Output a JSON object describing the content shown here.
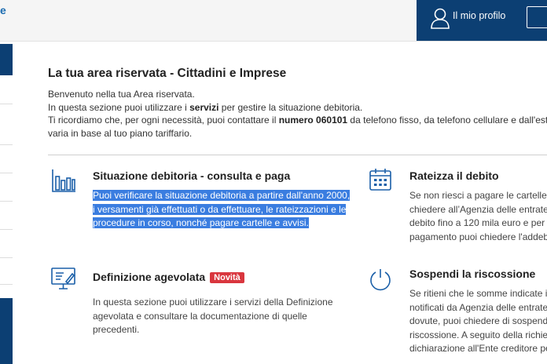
{
  "header": {
    "brand_fragment": "e",
    "profile_label": "Il mio profilo"
  },
  "page": {
    "title": "La tua area riservata - Cittadini e Imprese",
    "intro": {
      "line1": "Benvenuto nella tua Area riservata.",
      "line2_pre": "In questa sezione puoi utilizzare i ",
      "line2_bold": "servizi",
      "line2_post": " per gestire la situazione debitoria.",
      "line3_pre": "Ti ricordiamo che, per ogni necessità, puoi contattare il ",
      "line3_bold": "numero 060101",
      "line3_post": " da telefono fisso, da telefono cellulare e dall'estero",
      "line4": "varia in base al tuo piano tariffario."
    }
  },
  "cards": {
    "situazione": {
      "title": "Situazione debitoria - consulta e paga",
      "lines": [
        "Puoi verificare la situazione debitoria a partire dall'anno 2000,",
        "i versamenti già effettuati o da effettuare, le rateizzazioni e le",
        "procedure in corso, nonché pagare cartelle e avvisi."
      ]
    },
    "rateizza": {
      "title": "Rateizza il debito",
      "lines": [
        "Se non riesci a pagare le cartelle in",
        "chiedere all’Agenzia delle entrate-",
        "debito fino a 120 mila euro e per u",
        "pagamento puoi chiedere l'addebi"
      ]
    },
    "definizione": {
      "title": "Definizione agevolata",
      "badge": "Novità",
      "lines": [
        "In questa sezione puoi utilizzare i servizi della Definizione",
        "agevolata e consultare la documentazione di quelle",
        "precedenti."
      ]
    },
    "sospendi": {
      "title": "Sospendi la riscossione",
      "lines": [
        "Se ritieni che le somme indicate in",
        "notificati da Agenzia delle entrate",
        "dovute, puoi chiedere di sospende",
        "riscossione. A seguito della richies",
        "dichiarazione all'Ente creditore pe"
      ]
    }
  },
  "colors": {
    "brand_blue": "#0c3f73",
    "icon_blue": "#1a5fa8",
    "badge_red": "#d9363e",
    "highlight": "#3a7de0"
  }
}
